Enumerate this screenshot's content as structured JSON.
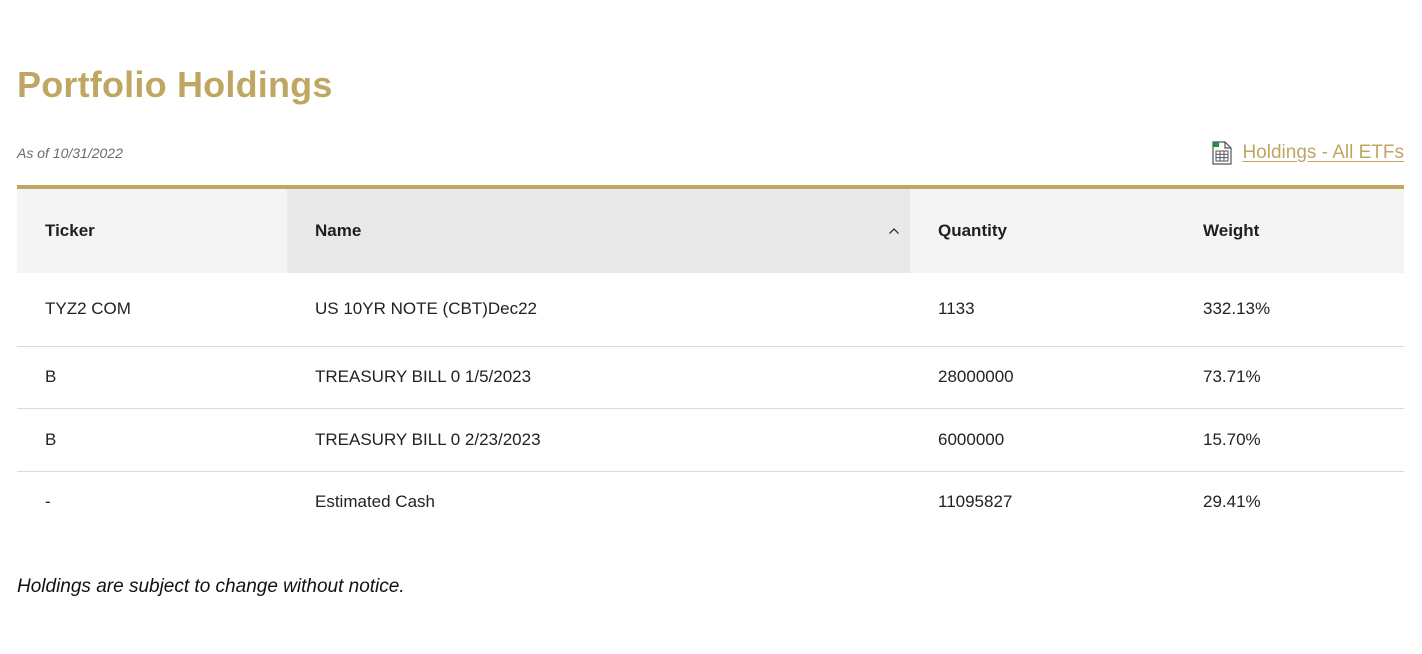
{
  "page": {
    "title": "Portfolio Holdings",
    "as_of": "As of 10/31/2022",
    "download_link": "Holdings - All ETFs",
    "download_icon": "spreadsheet-icon",
    "disclaimer": "Holdings are subject to change without notice."
  },
  "colors": {
    "accent": "#bfa763",
    "header_bg": "#f4f4f4",
    "sorted_header_bg": "#e9e9e9",
    "row_divider": "#d9d9d9"
  },
  "table": {
    "columns": [
      "Ticker",
      "Name",
      "Quantity",
      "Weight"
    ],
    "sorted_column": "Name",
    "sort_direction": "ascending",
    "rows": [
      [
        "TYZ2 COM",
        "US 10YR NOTE (CBT)Dec22",
        "1133",
        "332.13%"
      ],
      [
        "B",
        "TREASURY BILL 0 1/5/2023",
        "28000000",
        "73.71%"
      ],
      [
        "B",
        "TREASURY BILL 0 2/23/2023",
        "6000000",
        "15.70%"
      ],
      [
        "-",
        "Estimated Cash",
        "11095827",
        "29.41%"
      ]
    ]
  }
}
